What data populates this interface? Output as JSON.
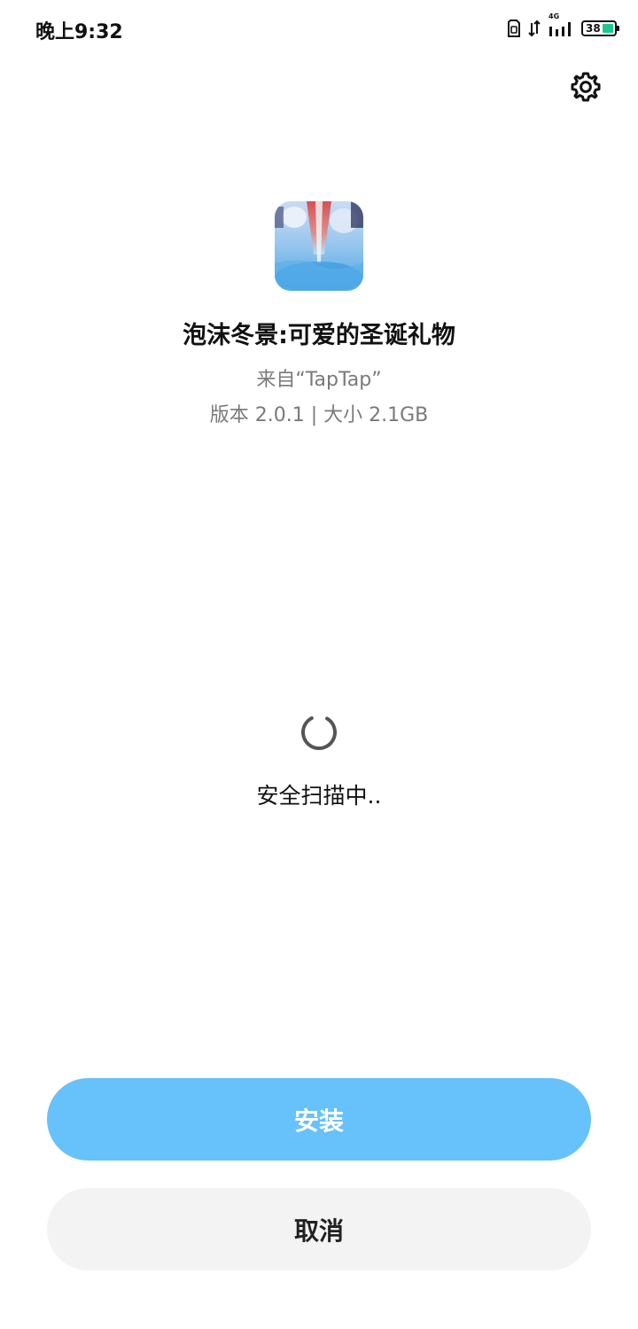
{
  "status_bar": {
    "time": "晚上9:32",
    "network_type": "4G",
    "battery_level": "38",
    "battery_percent": 38,
    "icons": [
      "sim-card-icon",
      "data-transfer-icon",
      "signal-icon",
      "battery-icon"
    ]
  },
  "header": {
    "settings_icon": "gear-icon"
  },
  "app": {
    "name": "泡沫冬景:可爱的圣诞礼物",
    "source": "来自“TapTap”",
    "meta": "版本 2.0.1 | 大小 2.1GB"
  },
  "scan": {
    "status": "安全扫描中.."
  },
  "actions": {
    "install_label": "安装",
    "cancel_label": "取消"
  },
  "colors": {
    "install_button": "#67c1fb",
    "cancel_button": "#f3f3f3",
    "battery_fill": "#1cc98d",
    "secondary_text": "#7a7a7a"
  }
}
